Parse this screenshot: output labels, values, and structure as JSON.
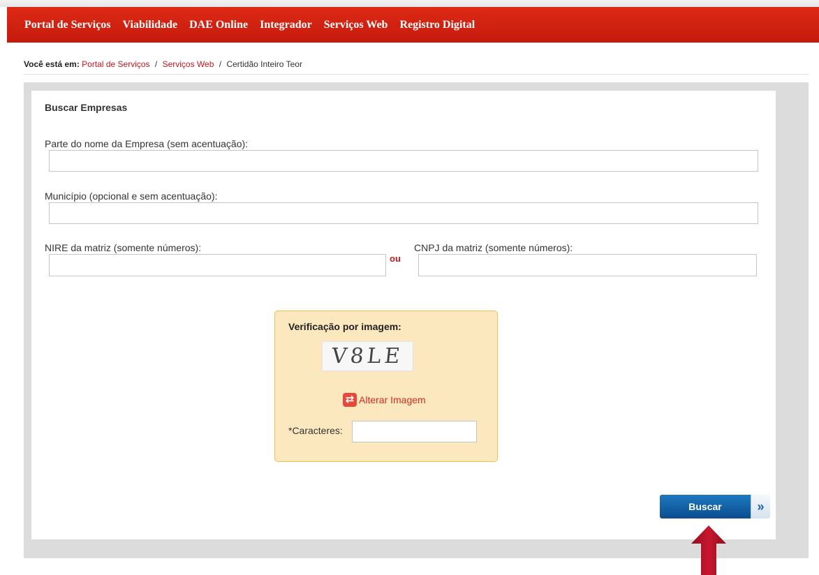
{
  "nav": {
    "items": [
      {
        "label": "Portal de Serviços"
      },
      {
        "label": "Viabilidade"
      },
      {
        "label": "DAE Online"
      },
      {
        "label": "Integrador"
      },
      {
        "label": "Serviços Web"
      },
      {
        "label": "Registro Digital"
      }
    ]
  },
  "breadcrumb": {
    "prefix": "Você está em:",
    "link1": "Portal de Serviços",
    "sep": "/",
    "link2": "Serviços Web",
    "current": "Certidão Inteiro Teor"
  },
  "form": {
    "title": "Buscar Empresas",
    "company_label": "Parte do nome da Empresa (sem acentuação):",
    "company_value": "",
    "city_label": "Município (opcional e sem acentuação):",
    "city_value": "",
    "nire_label": "NIRE da matriz (somente números):",
    "nire_value": "",
    "or_label": "ou",
    "cnpj_label": "CNPJ da matriz (somente números):",
    "cnpj_value": ""
  },
  "captcha": {
    "title": "Verificação por imagem:",
    "image_text": "V8LE",
    "refresh_label": "Alterar Imagem",
    "chars_label": "*Caracteres:",
    "chars_value": ""
  },
  "actions": {
    "search_label": "Buscar",
    "search_arrow": "»"
  },
  "colors": {
    "nav_red": "#c41a0c",
    "link_red": "#c8161d",
    "captcha_bg": "#fbe8be",
    "button_blue": "#0a4d8f",
    "pointer_arrow": "#b5122a"
  },
  "icons": {
    "refresh": "refresh-icon",
    "pointer": "up-arrow-icon"
  }
}
